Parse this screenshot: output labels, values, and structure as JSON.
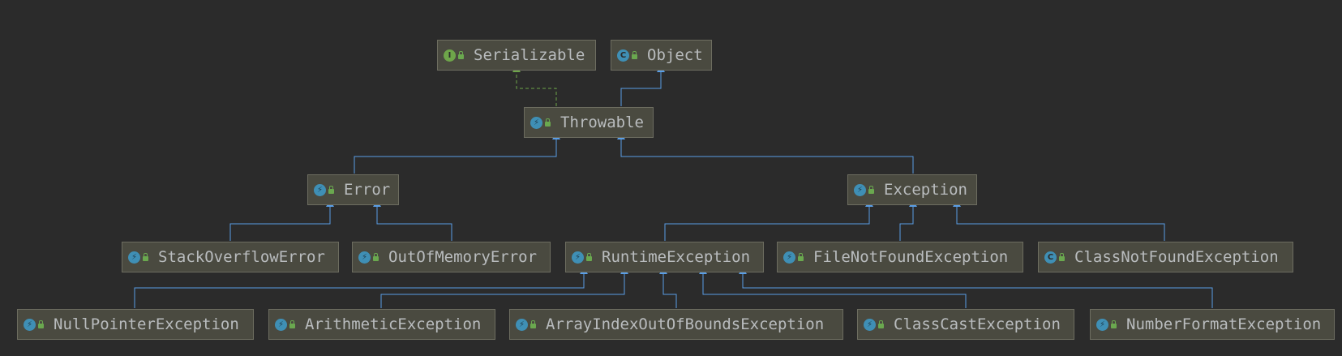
{
  "colors": {
    "background": "#2b2b2b",
    "node_fill": "#4a4a40",
    "node_border": "#6d6d60",
    "text": "#b9bcbe",
    "extends_edge": "#5a9ee6",
    "implements_edge": "#6ea54a"
  },
  "nodes": {
    "serializable": {
      "label": "Serializable",
      "kind": "interface",
      "icon": "interface-icon"
    },
    "object": {
      "label": "Object",
      "kind": "class",
      "icon": "class-icon"
    },
    "throwable": {
      "label": "Throwable",
      "kind": "throwable",
      "icon": "throwable-class-icon"
    },
    "error": {
      "label": "Error",
      "kind": "throwable",
      "icon": "throwable-class-icon"
    },
    "exception": {
      "label": "Exception",
      "kind": "throwable",
      "icon": "throwable-class-icon"
    },
    "stackoverflowerror": {
      "label": "StackOverflowError",
      "kind": "throwable",
      "icon": "throwable-class-icon"
    },
    "outofmemoryerror": {
      "label": "OutOfMemoryError",
      "kind": "throwable",
      "icon": "throwable-class-icon"
    },
    "runtimeexception": {
      "label": "RuntimeException",
      "kind": "throwable",
      "icon": "throwable-class-icon"
    },
    "filenotfoundexception": {
      "label": "FileNotFoundException",
      "kind": "throwable",
      "icon": "throwable-class-icon"
    },
    "classnotfoundexception": {
      "label": "ClassNotFoundException",
      "kind": "class",
      "icon": "class-icon"
    },
    "nullpointerexception": {
      "label": "NullPointerException",
      "kind": "throwable",
      "icon": "throwable-class-icon"
    },
    "arithmeticexception": {
      "label": "ArithmeticException",
      "kind": "throwable",
      "icon": "throwable-class-icon"
    },
    "arrayindexoutofboundsexception": {
      "label": "ArrayIndexOutOfBoundsException",
      "kind": "throwable",
      "icon": "throwable-class-icon"
    },
    "classcastexception": {
      "label": "ClassCastException",
      "kind": "throwable",
      "icon": "throwable-class-icon"
    },
    "numberformatexception": {
      "label": "NumberFormatException",
      "kind": "throwable",
      "icon": "throwable-class-icon"
    }
  },
  "edges": [
    {
      "from": "throwable",
      "to": "serializable",
      "relation": "implements"
    },
    {
      "from": "throwable",
      "to": "object",
      "relation": "extends"
    },
    {
      "from": "error",
      "to": "throwable",
      "relation": "extends"
    },
    {
      "from": "exception",
      "to": "throwable",
      "relation": "extends"
    },
    {
      "from": "stackoverflowerror",
      "to": "error",
      "relation": "extends"
    },
    {
      "from": "outofmemoryerror",
      "to": "error",
      "relation": "extends"
    },
    {
      "from": "runtimeexception",
      "to": "exception",
      "relation": "extends"
    },
    {
      "from": "filenotfoundexception",
      "to": "exception",
      "relation": "extends"
    },
    {
      "from": "classnotfoundexception",
      "to": "exception",
      "relation": "extends"
    },
    {
      "from": "nullpointerexception",
      "to": "runtimeexception",
      "relation": "extends"
    },
    {
      "from": "arithmeticexception",
      "to": "runtimeexception",
      "relation": "extends"
    },
    {
      "from": "arrayindexoutofboundsexception",
      "to": "runtimeexception",
      "relation": "extends"
    },
    {
      "from": "classcastexception",
      "to": "runtimeexception",
      "relation": "extends"
    },
    {
      "from": "numberformatexception",
      "to": "runtimeexception",
      "relation": "extends"
    }
  ]
}
